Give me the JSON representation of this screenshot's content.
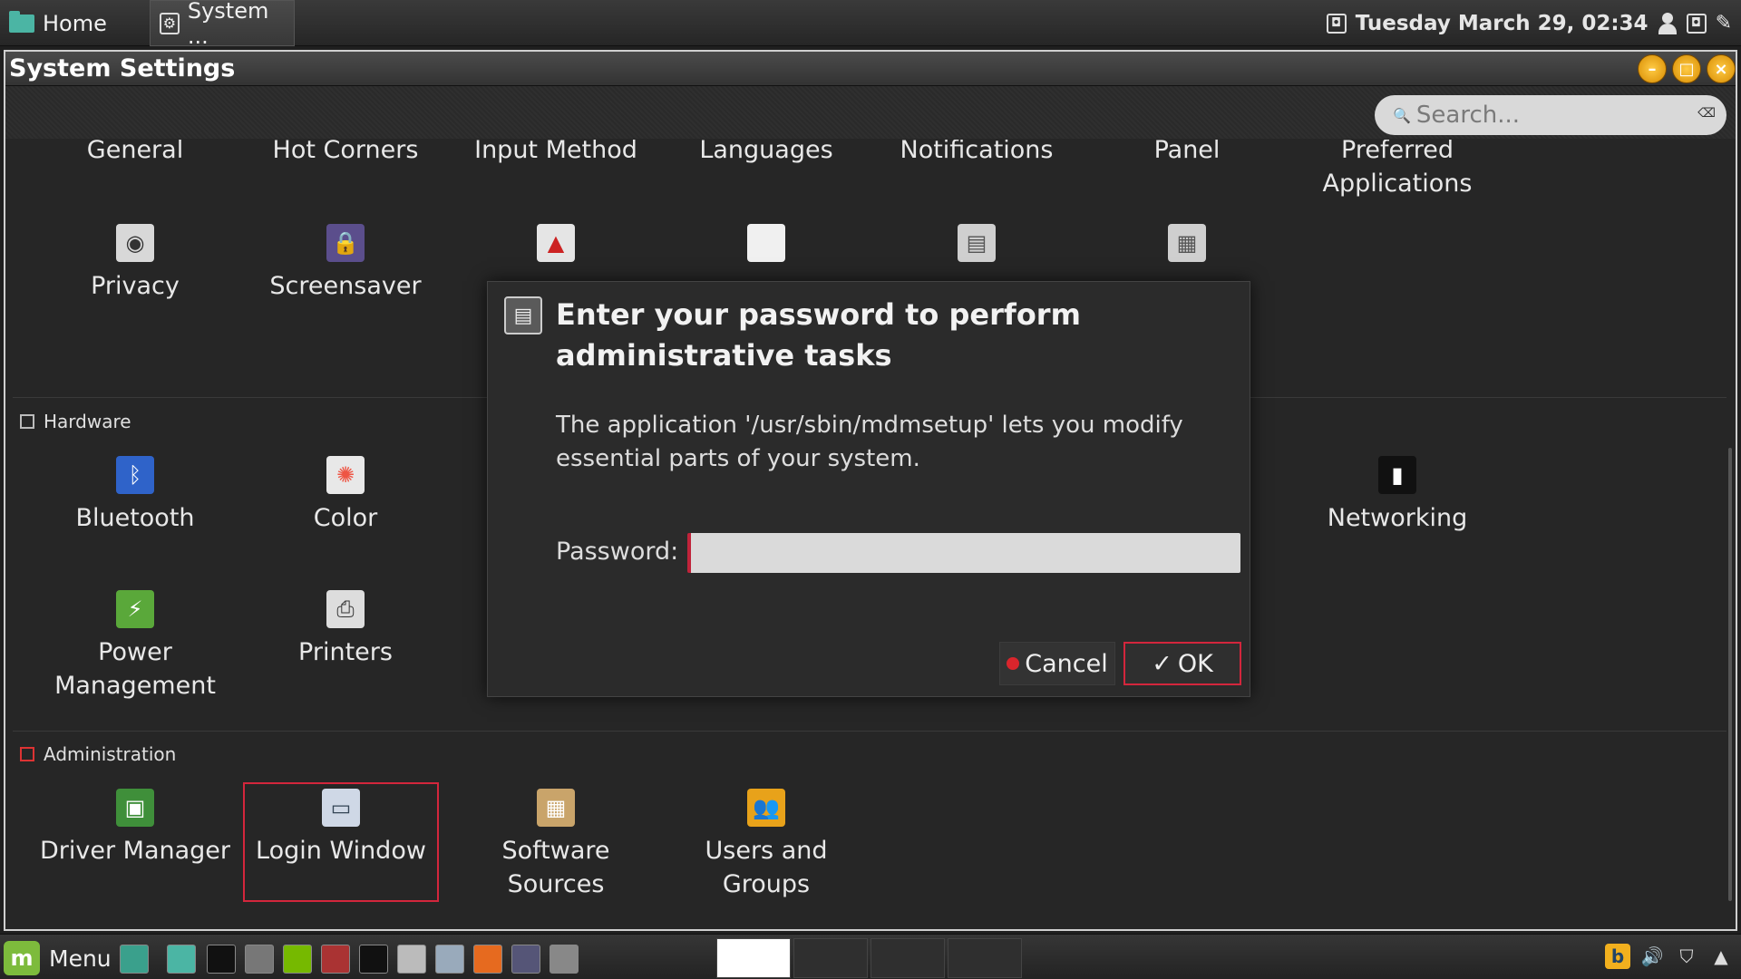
{
  "top_panel": {
    "tasks": [
      {
        "label": "Home"
      },
      {
        "label": "System ..."
      }
    ],
    "clock": "Tuesday March 29, 02:34"
  },
  "window": {
    "title": "System Settings",
    "search_placeholder": "Search..."
  },
  "personal_items": [
    "General",
    "Hot Corners",
    "Input Method",
    "Languages",
    "Notifications",
    "Panel",
    "Preferred Applications",
    "Privacy",
    "Screensaver"
  ],
  "hardware": {
    "header": "Hardware",
    "items": [
      "Bluetooth",
      "Color",
      "Networking",
      "Power Management",
      "Printers"
    ]
  },
  "administration": {
    "header": "Administration",
    "items": [
      "Driver Manager",
      "Login Window",
      "Software Sources",
      "Users and Groups"
    ]
  },
  "dialog": {
    "title": "Enter your password to perform administrative tasks",
    "message": "The application '/usr/sbin/mdmsetup' lets you modify essential parts of your system.",
    "password_label": "Password:",
    "password_value": "",
    "cancel_label": "Cancel",
    "ok_label": "OK"
  },
  "bottom_panel": {
    "menu_label": "Menu"
  },
  "colors": {
    "accent_red": "#d3263c",
    "mint_green": "#7dbb3c",
    "folder_teal": "#4bb5a4"
  }
}
